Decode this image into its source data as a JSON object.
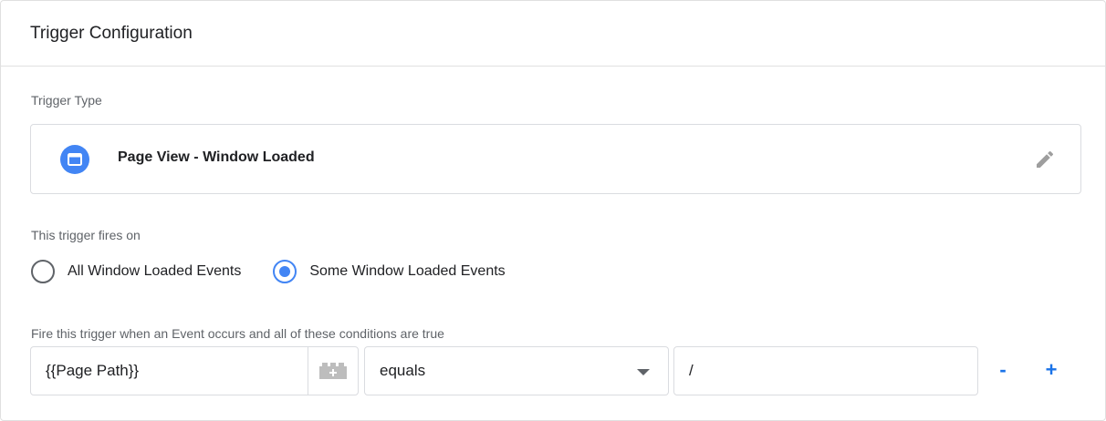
{
  "header": {
    "title": "Trigger Configuration"
  },
  "trigger_type": {
    "label": "Trigger Type",
    "name": "Page View - Window Loaded",
    "icon": "browser-window-icon",
    "edit_icon": "pencil-icon"
  },
  "fires_on": {
    "label": "This trigger fires on",
    "options": [
      {
        "label": "All Window Loaded Events",
        "selected": false
      },
      {
        "label": "Some Window Loaded Events",
        "selected": true
      }
    ]
  },
  "conditions": {
    "label": "Fire this trigger when an Event occurs and all of these conditions are true",
    "rows": [
      {
        "variable": "{{Page Path}}",
        "operator": "equals",
        "value": "/"
      }
    ],
    "remove_label": "-",
    "add_label": "+"
  },
  "colors": {
    "accent": "#4285f4",
    "link": "#1a73e8",
    "border": "#dadce0",
    "muted": "#5f6368"
  }
}
